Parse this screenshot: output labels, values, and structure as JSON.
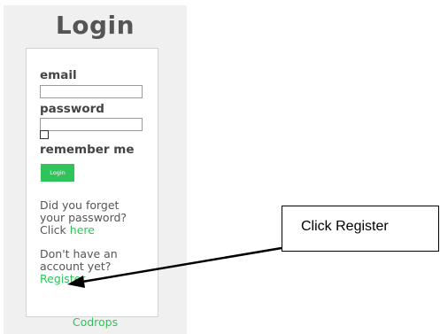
{
  "login": {
    "title": "Login",
    "email_label": "email",
    "email_value": "",
    "password_label": "password",
    "password_value": "",
    "remember_label": "remember me",
    "remember_checked": false,
    "login_button": "Login",
    "forgot_text_line1": "Did you forget",
    "forgot_text_line2": "your password?",
    "forgot_click": "Click",
    "forgot_link": "here",
    "account_text_line1": "Don't have an",
    "account_text_line2": "account yet?",
    "register_link": "Register",
    "footer_link": "Codrops"
  },
  "annotation": {
    "callout_text": "Click Register"
  },
  "colors": {
    "accent": "#2ec45a",
    "panel_bg": "#f0f0f0",
    "title": "#555555"
  }
}
